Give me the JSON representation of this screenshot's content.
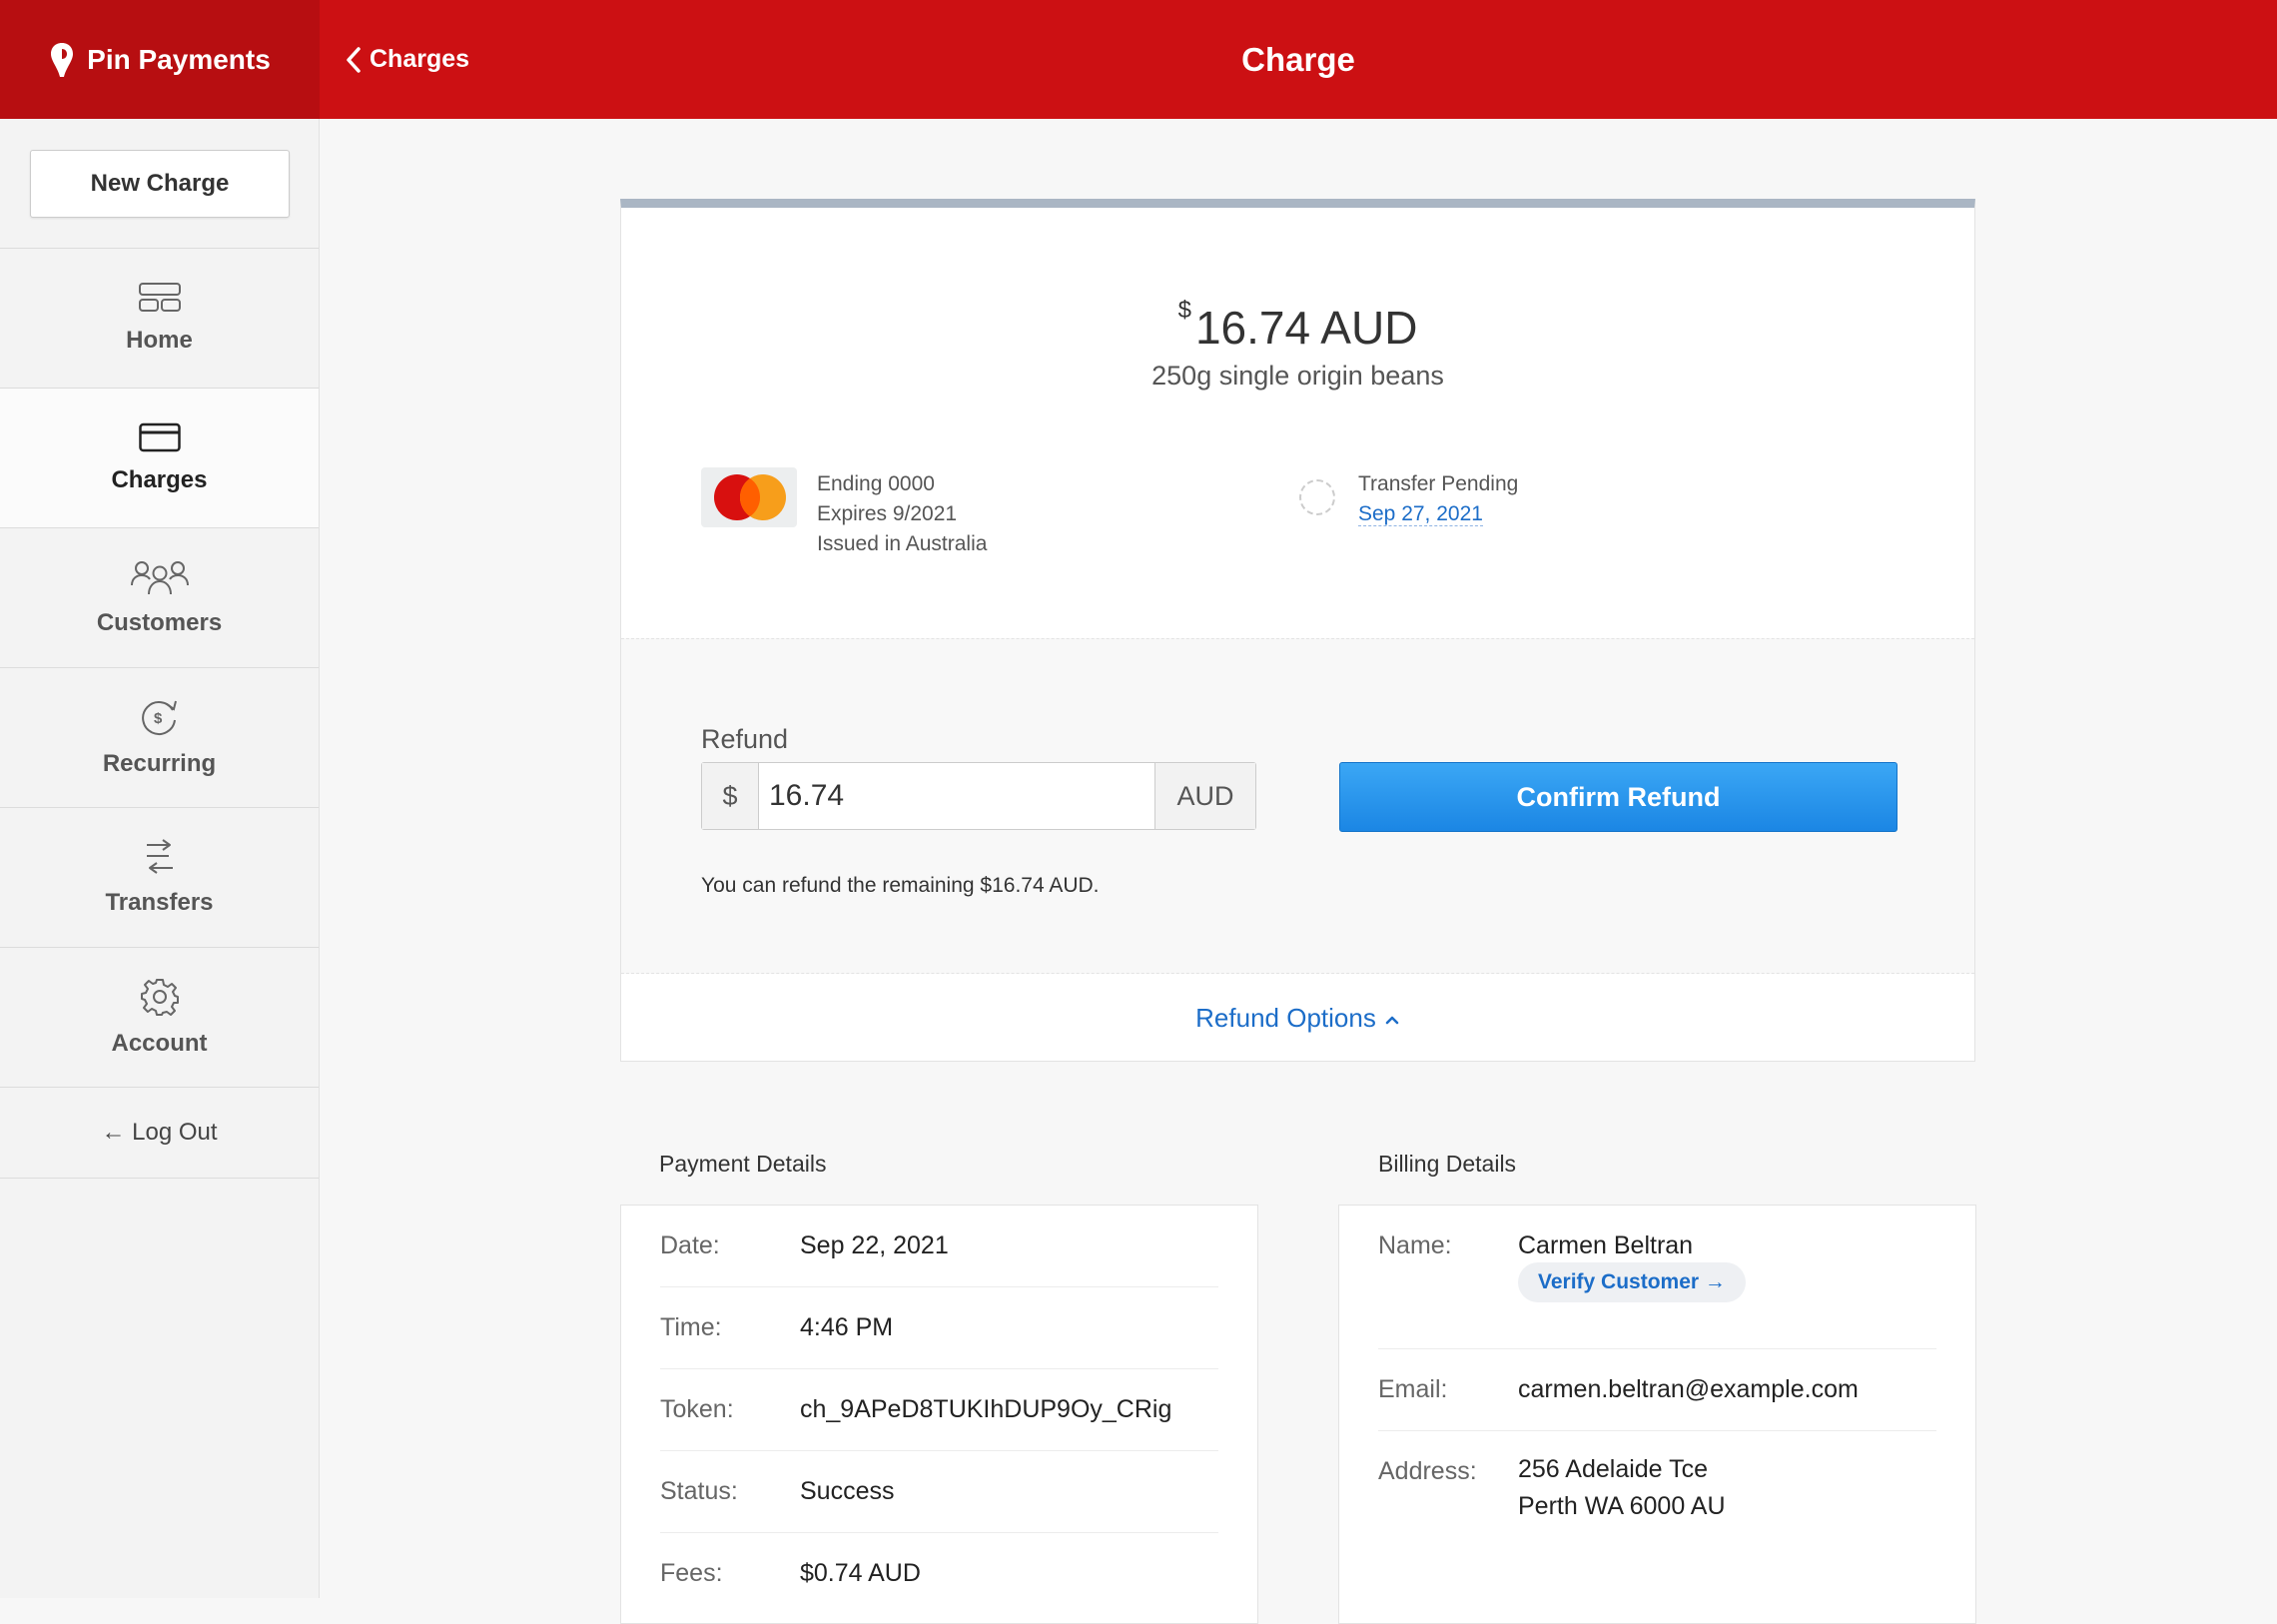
{
  "brand": {
    "name": "Pin Payments"
  },
  "header": {
    "back_label": "Charges",
    "title": "Charge"
  },
  "sidebar": {
    "new_charge": "New Charge",
    "items": [
      {
        "label": "Home",
        "icon": "home-icon"
      },
      {
        "label": "Charges",
        "icon": "card-icon",
        "active": true
      },
      {
        "label": "Customers",
        "icon": "customers-icon"
      },
      {
        "label": "Recurring",
        "icon": "recurring-icon"
      },
      {
        "label": "Transfers",
        "icon": "transfers-icon"
      },
      {
        "label": "Account",
        "icon": "gear-icon"
      }
    ],
    "logout": "← Log Out"
  },
  "charge": {
    "currency_symbol": "$",
    "amount": "16.74 AUD",
    "description": "250g single origin beans",
    "card": {
      "ending": "Ending 0000",
      "expires": "Expires 9/2021",
      "issued": "Issued in Australia",
      "brand_icon": "mastercard-icon"
    },
    "transfer": {
      "status": "Transfer Pending",
      "date": "Sep 27, 2021"
    }
  },
  "refund": {
    "label": "Refund",
    "prefix": "$",
    "value": "16.74",
    "suffix": "AUD",
    "confirm_label": "Confirm Refund",
    "note": "You can refund the remaining $16.74 AUD.",
    "options_label": "Refund Options"
  },
  "payment_details": {
    "title": "Payment Details",
    "rows": [
      {
        "key": "Date:",
        "value": "Sep 22, 2021"
      },
      {
        "key": "Time:",
        "value": "4:46 PM"
      },
      {
        "key": "Token:",
        "value": "ch_9APeD8TUKIhDUP9Oy_CRig"
      },
      {
        "key": "Status:",
        "value": "Success"
      },
      {
        "key": "Fees:",
        "value": "$0.74 AUD"
      }
    ]
  },
  "billing_details": {
    "title": "Billing Details",
    "name_key": "Name:",
    "name": "Carmen Beltran",
    "verify_label": "Verify Customer →",
    "email_key": "Email:",
    "email": "carmen.beltran@example.com",
    "address_key": "Address:",
    "address_line1": "256 Adelaide Tce",
    "address_line2": "Perth WA 6000 AU"
  },
  "colors": {
    "brand_red": "#cc1013",
    "brand_red_dark": "#b70e11",
    "accent_blue": "#1c6dc8",
    "button_blue": "#1b86e4"
  }
}
